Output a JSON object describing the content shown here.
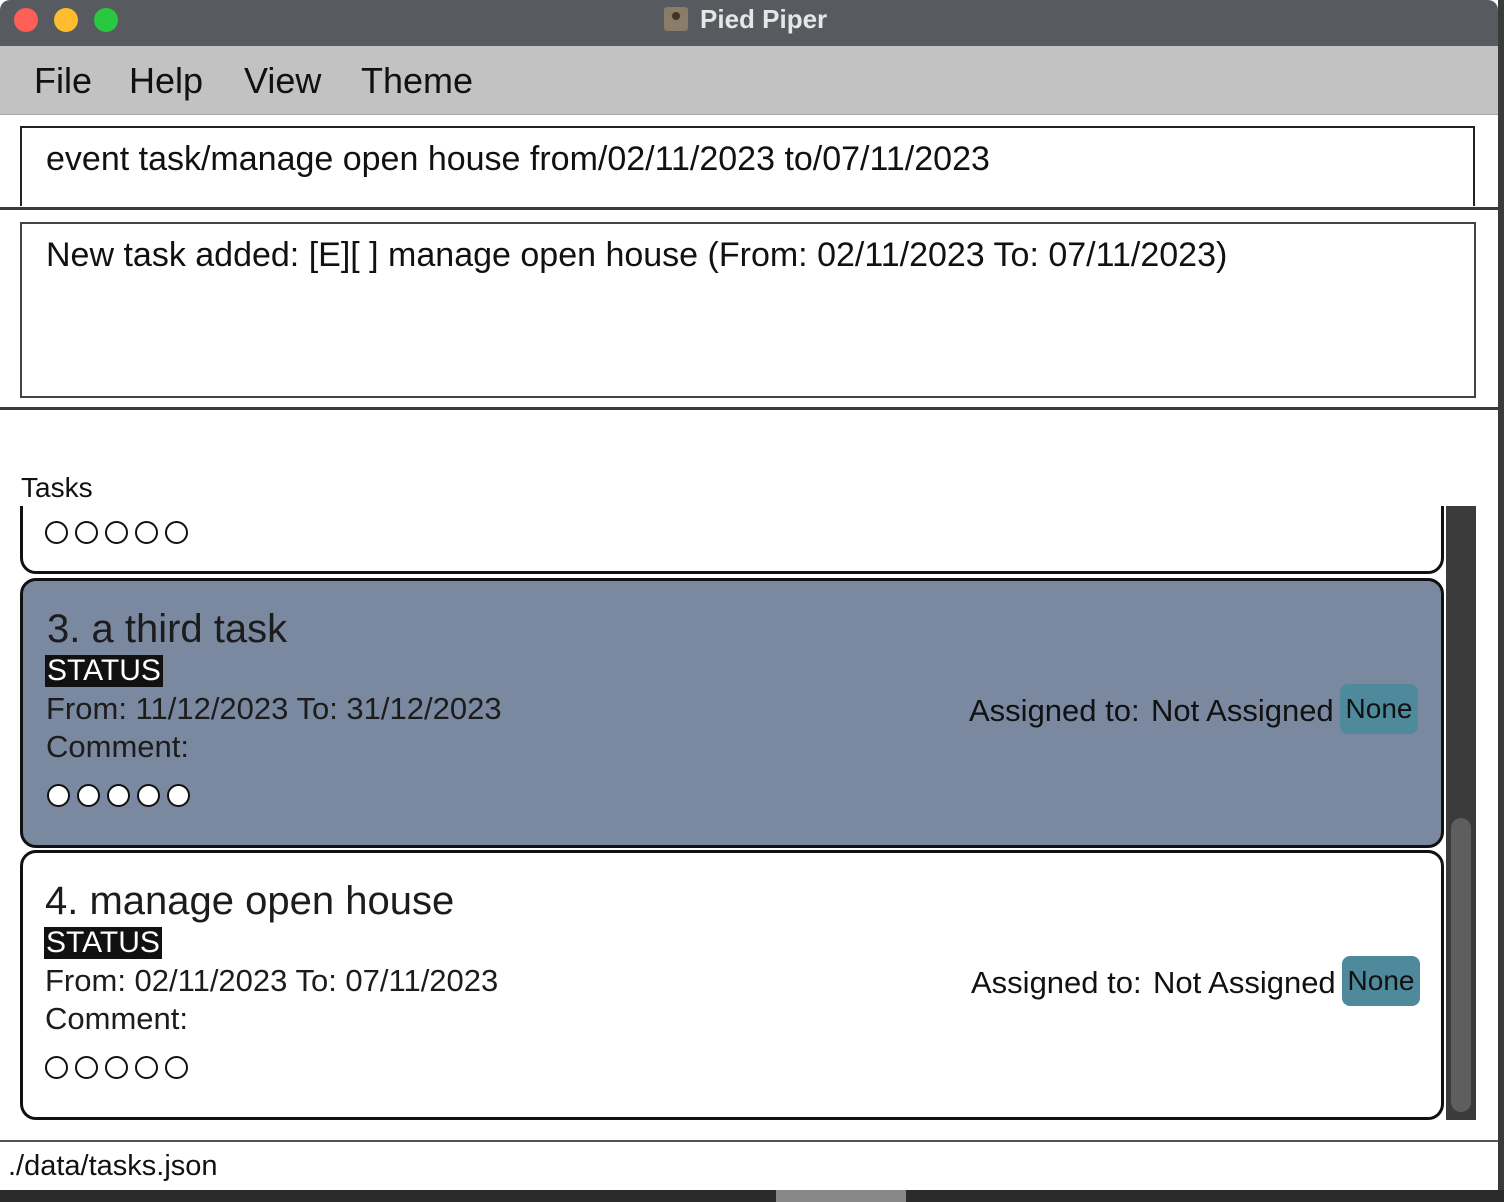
{
  "window": {
    "title": "Pied Piper"
  },
  "menu": {
    "items": [
      "File",
      "Help",
      "View",
      "Theme"
    ]
  },
  "command": {
    "value": "event task/manage open house from/02/11/2023 to/07/11/2023"
  },
  "result": {
    "message": "New task added: [E][ ] manage open house (From: 02/11/2023 To: 07/11/2023)"
  },
  "tasks_label": "Tasks",
  "tasks": [
    {
      "title": "3. a third task",
      "status": "STATUS",
      "dates": "From: 11/12/2023 To: 31/12/2023",
      "comment": "Comment:",
      "assigned_label": "Assigned to:",
      "assignee": "Not Assigned",
      "badge": "None",
      "selected": true
    },
    {
      "title": "4. manage open house",
      "status": "STATUS",
      "dates": "From: 02/11/2023 To: 07/11/2023",
      "comment": "Comment:",
      "assigned_label": "Assigned to:",
      "assignee": "Not Assigned",
      "badge": "None",
      "selected": false
    }
  ],
  "statusbar": {
    "path": "./data/tasks.json"
  },
  "colors": {
    "selected_card": "#7a89a0",
    "badge": "#4e8a9c",
    "titlebar": "#575b60",
    "menubar": "#c2c2c2"
  }
}
